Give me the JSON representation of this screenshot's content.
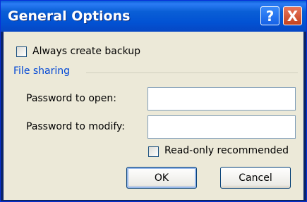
{
  "dialog": {
    "title": "General Options",
    "help_glyph": "?",
    "close_glyph": "X"
  },
  "backup": {
    "label": "Always create backup",
    "checked": false
  },
  "file_sharing": {
    "section_label": "File sharing",
    "password_open_label": "Password to open:",
    "password_open_value": "",
    "password_modify_label": "Password to modify:",
    "password_modify_value": "",
    "readonly_label": "Read-only recommended",
    "readonly_checked": false
  },
  "buttons": {
    "ok": "OK",
    "cancel": "Cancel"
  },
  "colors": {
    "titlebar": "#0a5fd6",
    "section_label": "#0046d5",
    "close_button": "#c4431e",
    "face": "#ece9d8"
  },
  "icons": {
    "help": "help-icon",
    "close": "close-icon"
  }
}
